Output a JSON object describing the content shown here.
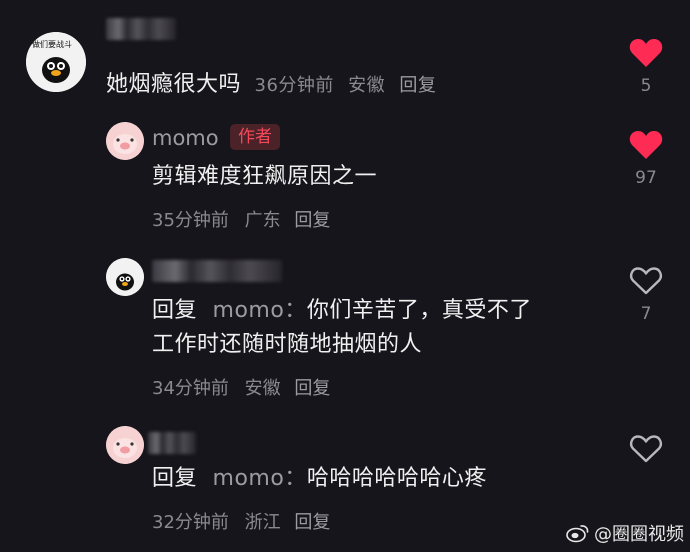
{
  "comments": [
    {
      "avatar_text": "做们要战斗",
      "text": "她烟瘾很大吗",
      "time": "36分钟前",
      "location": "安徽",
      "reply_label": "回复",
      "likes": "5",
      "liked": true
    },
    {
      "name": "momo",
      "badge": "作者",
      "text": "剪辑难度狂飙原因之一",
      "time": "35分钟前",
      "location": "广东",
      "reply_label": "回复",
      "likes": "97",
      "liked": true
    },
    {
      "avatar_text": "做们要战斗",
      "reply_prefix": "回复",
      "reply_target": "momo：",
      "text_line1": "你们辛苦了，真受不了",
      "text_line2": "工作时还随时随地抽烟的人",
      "time": "34分钟前",
      "location": "安徽",
      "reply_label": "回复",
      "likes": "7",
      "liked": false
    },
    {
      "reply_prefix": "回复",
      "reply_target": "momo：",
      "text": "哈哈哈哈哈哈心疼",
      "time": "32分钟前",
      "location": "浙江",
      "reply_label": "回复",
      "likes": "",
      "liked": false
    }
  ],
  "watermark": "@圈圈视频",
  "colors": {
    "background": "#16151b",
    "like_active": "#fe2c55",
    "badge": "#f4495a"
  }
}
